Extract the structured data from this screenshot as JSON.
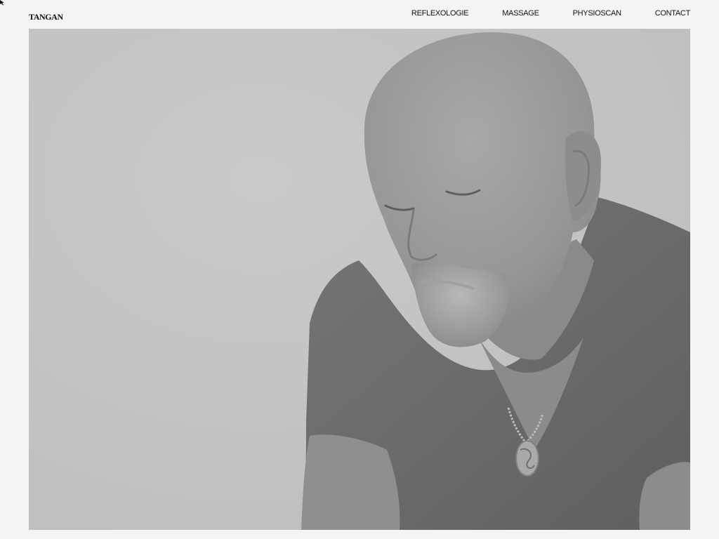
{
  "header": {
    "logo": "TANGAN",
    "nav": [
      {
        "label": "REFLEXOLOGIE"
      },
      {
        "label": "MASSAGE"
      },
      {
        "label": "PHYSIOSCAN"
      },
      {
        "label": "CONTACT"
      }
    ]
  },
  "hero": {
    "background_color": "#c4c4c4",
    "shirt_color": "#6e6e6e",
    "skin_color": "#9a9a9a"
  }
}
